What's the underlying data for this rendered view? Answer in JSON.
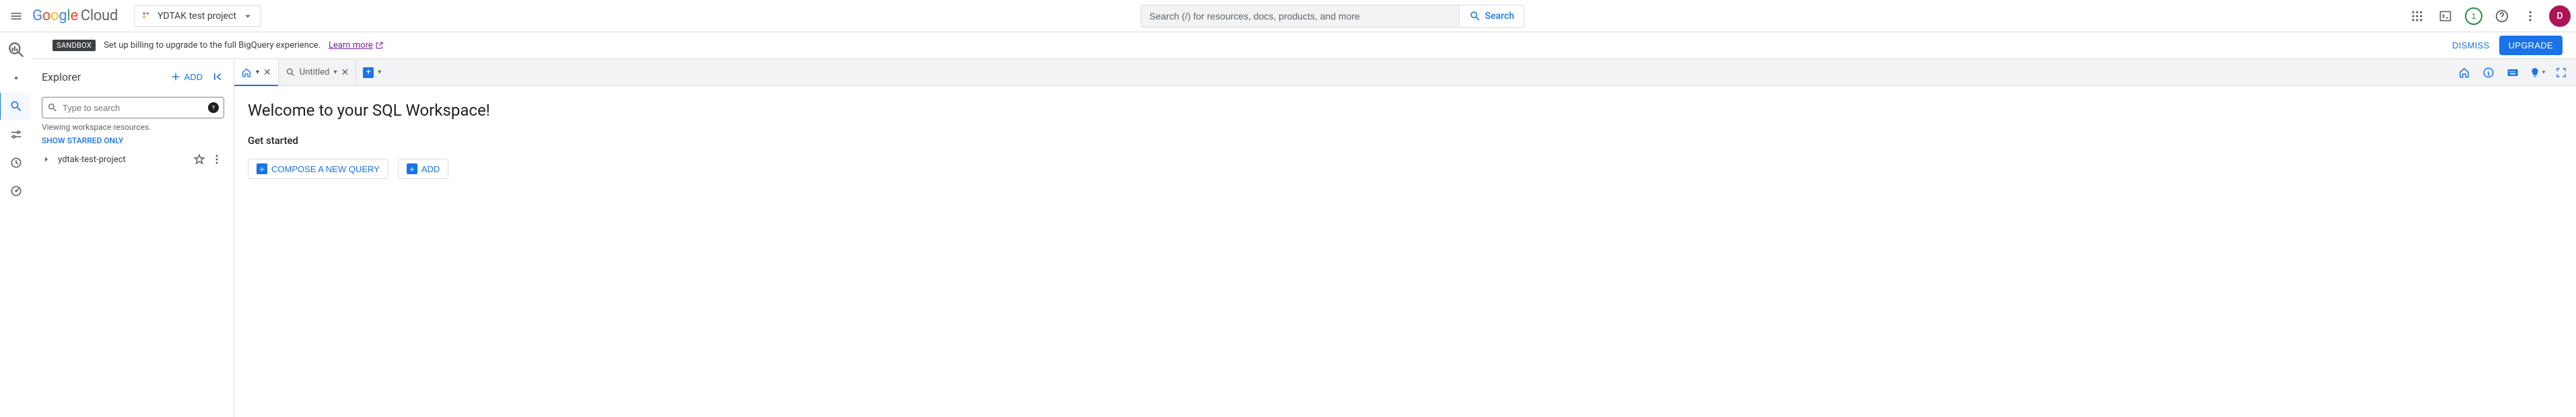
{
  "header": {
    "logo_cloud": "Cloud",
    "project_name": "YDTAK test project",
    "search_placeholder": "Search (/) for resources, docs, products, and more",
    "search_button": "Search",
    "notification_count": "1",
    "avatar_initial": "D"
  },
  "banner": {
    "badge": "SANDBOX",
    "message": "Set up billing to upgrade to the full BigQuery experience.",
    "link_label": "Learn more",
    "dismiss": "DISMISS",
    "upgrade": "UPGRADE"
  },
  "explorer": {
    "title": "Explorer",
    "add_label": "ADD",
    "search_placeholder": "Type to search",
    "hint": "Viewing workspace resources.",
    "starred_label": "SHOW STARRED ONLY",
    "project_row": "ydtak-test-project"
  },
  "tabs": {
    "untitled_label": "Untitled"
  },
  "content": {
    "welcome": "Welcome to your SQL Workspace!",
    "get_started": "Get started",
    "compose": "COMPOSE A NEW QUERY",
    "add": "ADD"
  }
}
